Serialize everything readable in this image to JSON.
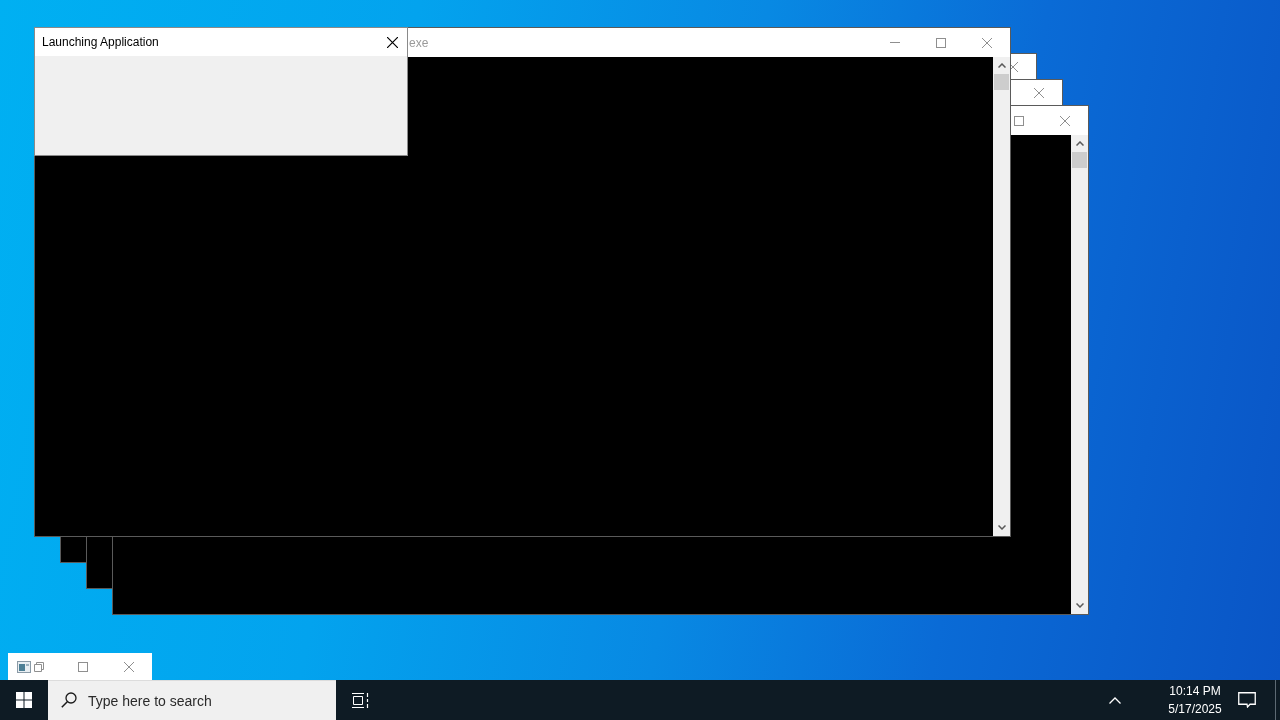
{
  "windows": [
    {
      "kind": "console",
      "title": "exe",
      "active": false,
      "scrollbar": true,
      "controls": [
        {
          "kind": "minimize"
        },
        {
          "kind": "maximize"
        },
        {
          "kind": "close"
        }
      ]
    },
    {
      "kind": "console",
      "active": false,
      "controls": [
        {
          "kind": "close"
        }
      ]
    },
    {
      "kind": "console",
      "active": false,
      "controls": [
        {
          "kind": "close"
        }
      ]
    },
    {
      "kind": "console",
      "active": false,
      "scrollbar": true,
      "controls": [
        {
          "kind": "maximize"
        },
        {
          "kind": "close"
        }
      ]
    }
  ],
  "dialog": {
    "title": "Launching Application",
    "active": true
  },
  "minimized_window": {
    "active": false
  },
  "taskbar": {
    "search": {
      "placeholder": "Type here to search"
    },
    "clock": {
      "time": "10:14 PM",
      "date": "5/17/2025"
    }
  }
}
